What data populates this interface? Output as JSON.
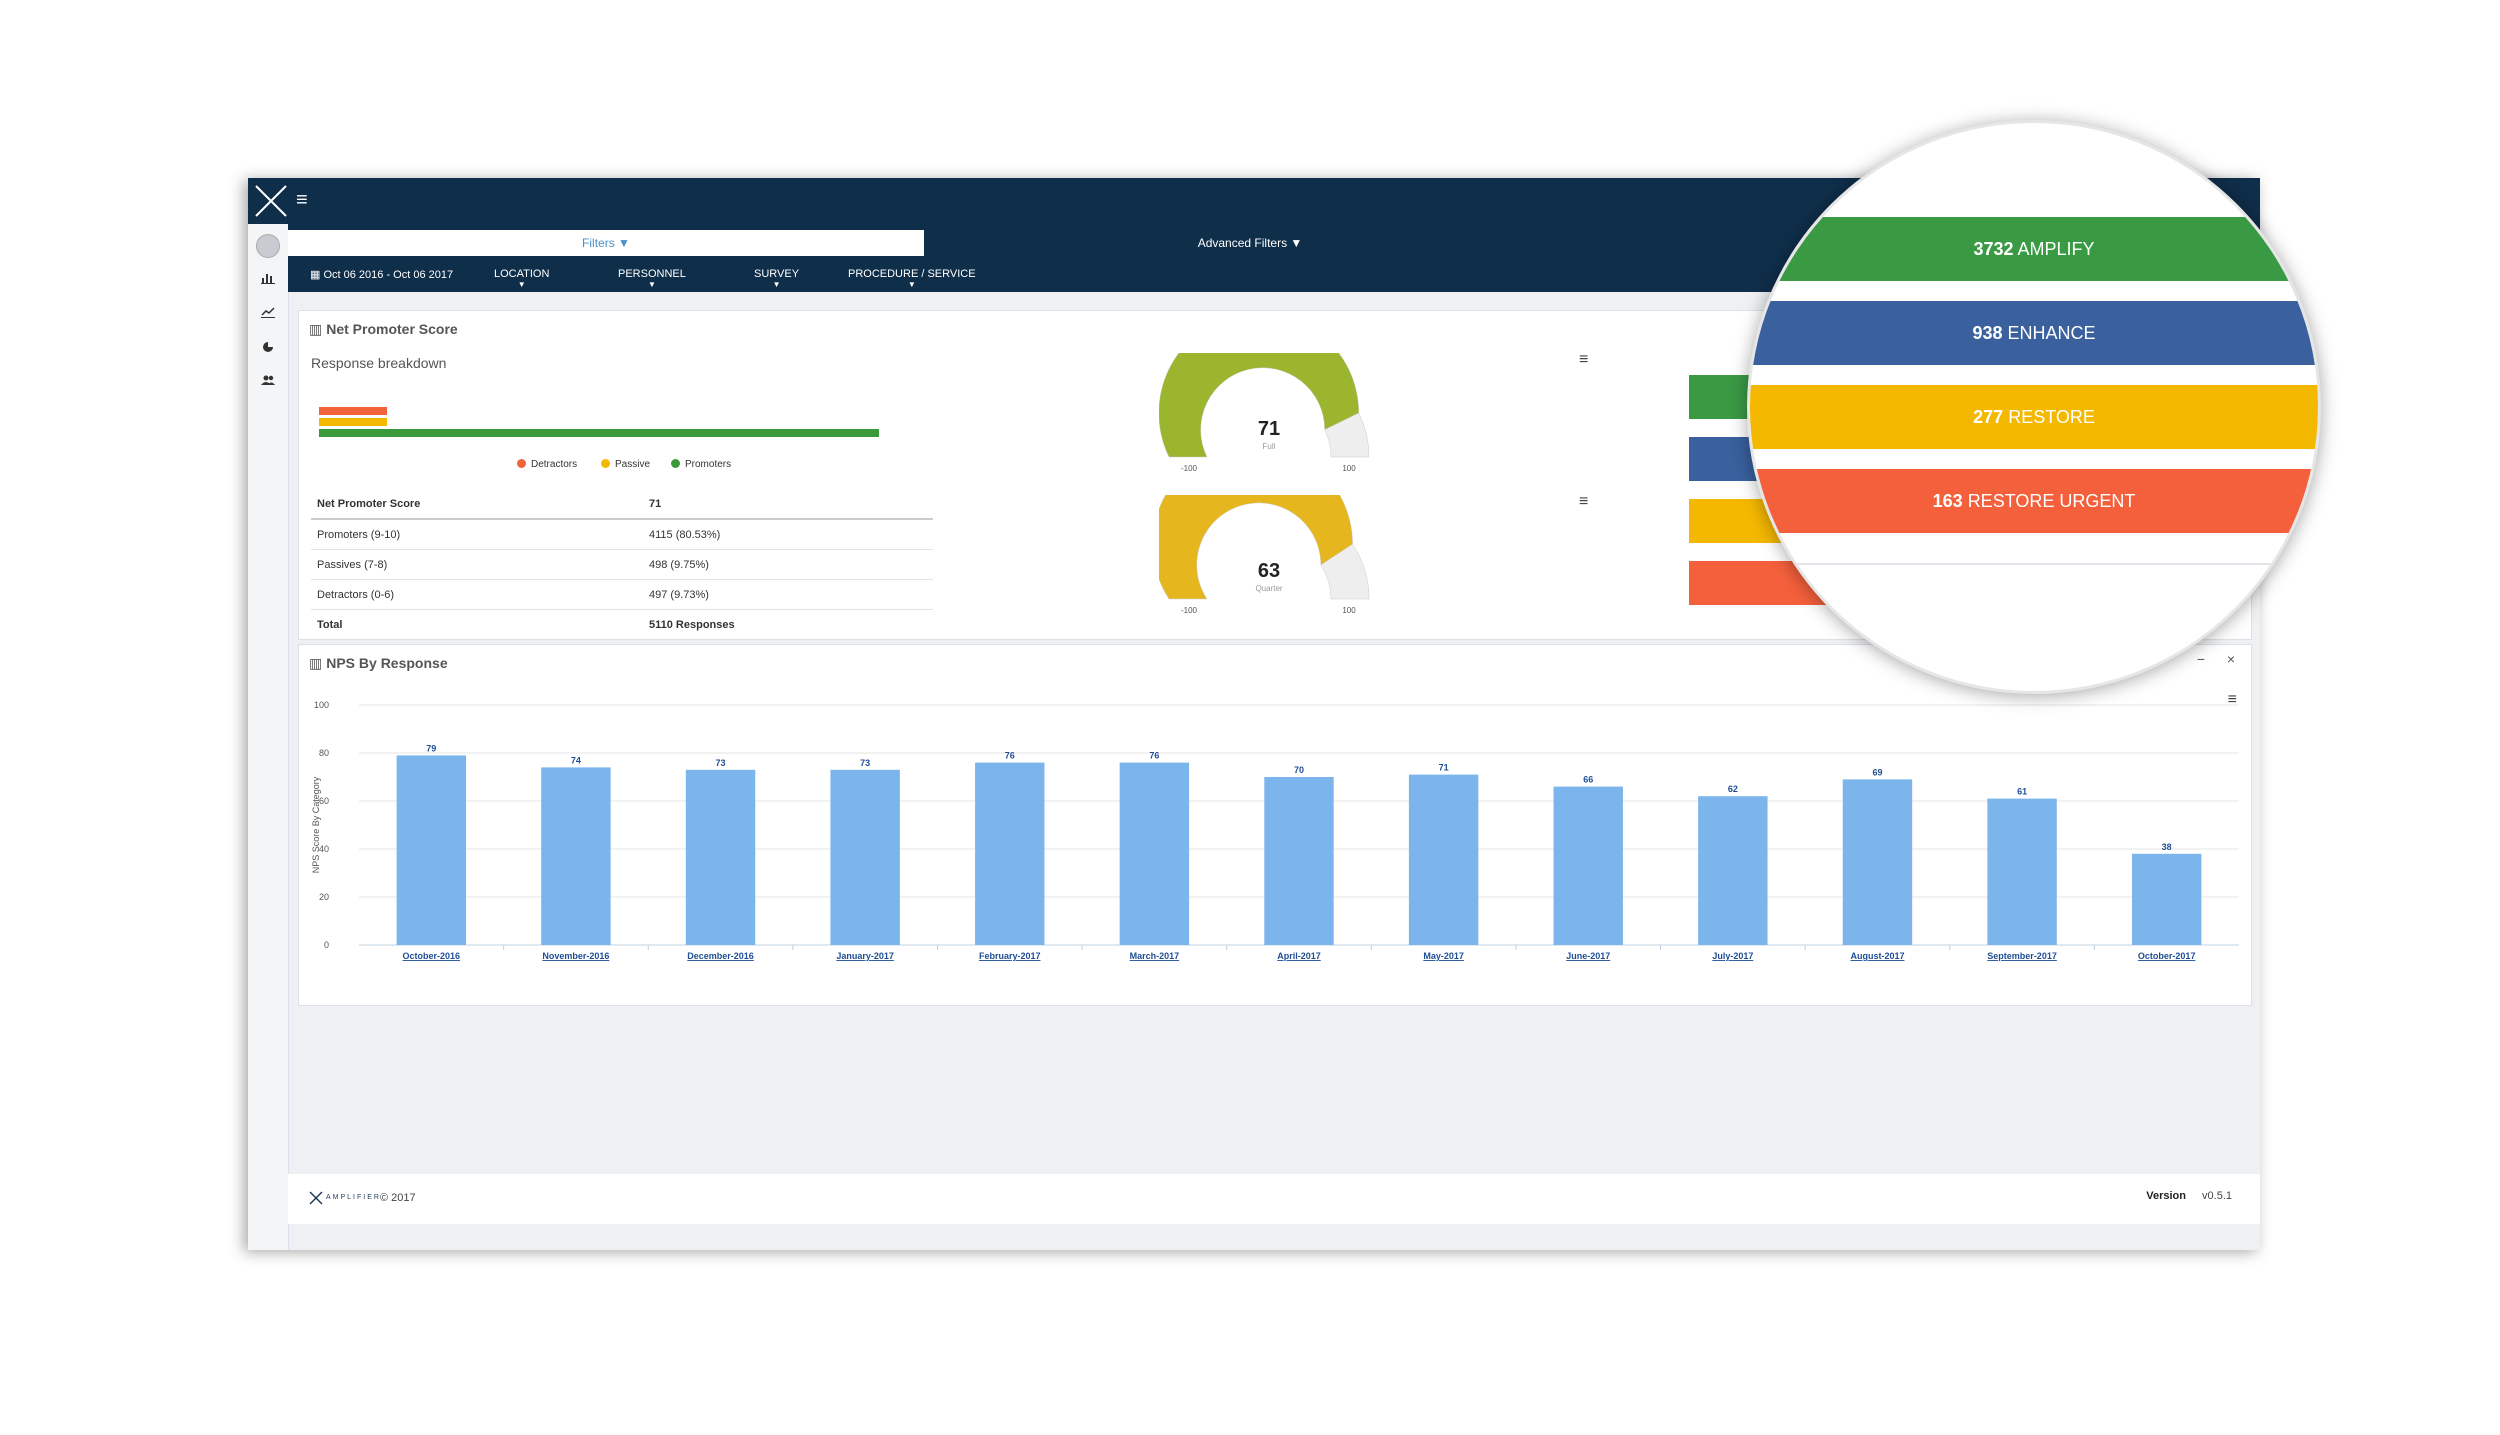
{
  "topbar": {
    "menu_icon": "hamburger-icon"
  },
  "sidebar": {
    "icons": [
      "bar-chart-icon",
      "line-chart-icon",
      "pie-chart-icon",
      "users-icon"
    ]
  },
  "filters": {
    "filters_tab": "Filters ▼",
    "advanced_filters": "Advanced Filters ▼",
    "date_range": "Oct 06 2016 - Oct 06 2017",
    "location": "LOCATION",
    "personnel": "PERSONNEL",
    "survey": "SURVEY",
    "procedure": "PROCEDURE / SERVICE"
  },
  "nps_panel": {
    "title": "Net Promoter Score",
    "subtitle": "Response breakdown",
    "legend": [
      {
        "label": "Detractors",
        "color": "#f0643c"
      },
      {
        "label": "Passive",
        "color": "#f5b800"
      },
      {
        "label": "Promoters",
        "color": "#3a9a3a"
      }
    ],
    "table": {
      "header": {
        "label": "Net Promoter Score",
        "value": "71"
      },
      "rows": [
        {
          "label": "Promoters (9-10)",
          "value": "4115 (80.53%)"
        },
        {
          "label": "Passives (7-8)",
          "value": "498 (9.75%)"
        },
        {
          "label": "Detractors (0-6)",
          "value": "497 (9.73%)"
        }
      ],
      "total": {
        "label": "Total",
        "value": "5110 Responses"
      }
    },
    "gauges": [
      {
        "value": "71",
        "label": "Full",
        "min": "-100",
        "max": "100",
        "fraction": 0.855,
        "color": "#9bb52e"
      },
      {
        "value": "63",
        "label": "Quarter",
        "min": "-100",
        "max": "100",
        "fraction": 0.815,
        "color": "#e6b61e"
      }
    ],
    "status_bars": [
      {
        "color": "#3a9a44",
        "text": ""
      },
      {
        "color": "#3a609e",
        "text": ""
      },
      {
        "color": "#f5b800",
        "text": ""
      },
      {
        "color": "#f4603c",
        "text": "163"
      }
    ]
  },
  "magnifier": {
    "bars": [
      {
        "count": "3732",
        "label": "AMPLIFY",
        "color": "#3a9a44"
      },
      {
        "count": "938",
        "label": "ENHANCE",
        "color": "#3a609e"
      },
      {
        "count": "277",
        "label": "RESTORE",
        "color": "#f5b800"
      },
      {
        "count": "163",
        "label": "RESTORE URGENT",
        "color": "#f4603c"
      }
    ]
  },
  "chart_panel": {
    "title": "NPS By Response",
    "minimize": "−",
    "close": "×"
  },
  "chart_data": {
    "type": "bar",
    "categories": [
      "October-2016",
      "November-2016",
      "December-2016",
      "January-2017",
      "February-2017",
      "March-2017",
      "April-2017",
      "May-2017",
      "June-2017",
      "July-2017",
      "August-2017",
      "September-2017",
      "October-2017"
    ],
    "values": [
      79,
      74,
      73,
      73,
      76,
      76,
      70,
      71,
      66,
      62,
      69,
      61,
      38
    ],
    "ylabel": "NPS Score By Category",
    "ylim": [
      0,
      100
    ],
    "yticks": [
      0,
      20,
      40,
      60,
      80,
      100
    ],
    "bar_color": "#7cb5ec",
    "grid": true
  },
  "footer": {
    "brand": "AMPLIFIER",
    "copyright": "© 2017",
    "version_label": "Version",
    "version": "v0.5.1"
  }
}
